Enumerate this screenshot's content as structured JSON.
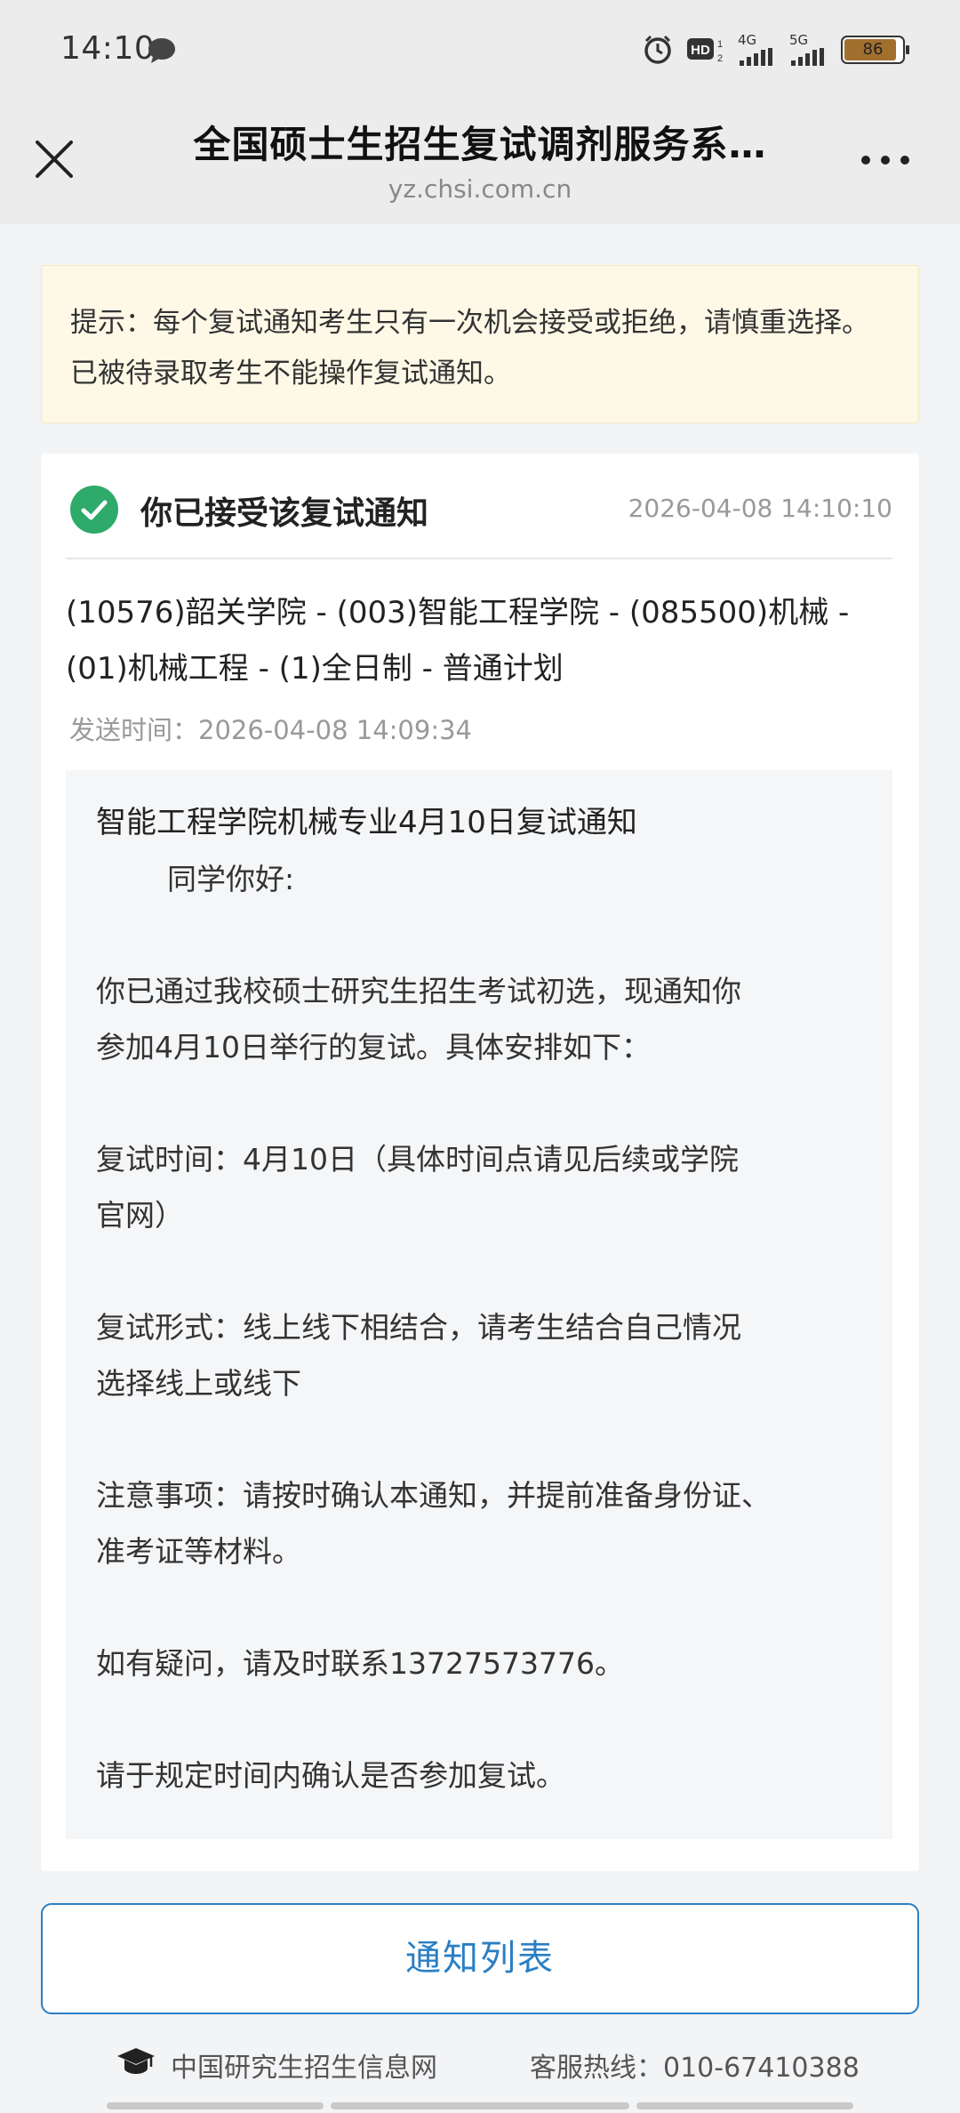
{
  "status_bar": {
    "time": "14:10",
    "network_1": "4G",
    "network_2": "5G",
    "hd_label": "HD",
    "battery": "86"
  },
  "header": {
    "title": "全国硕士生招生复试调剂服务系…",
    "url": "yz.chsi.com.cn"
  },
  "notice": {
    "text": "提示：每个复试通知考生只有一次机会接受或拒绝，请慎重选择。已被待录取考生不能操作复试通知。"
  },
  "card": {
    "status_text": "你已接受该复试通知",
    "status_time": "2026-04-08 14:10:10",
    "program_line1": "(10576)韶关学院 - (003)智能工程学院 - (085500)机械 -",
    "program_line2": "(01)机械工程 - (1)全日制 - 普通计划",
    "sent_time": "发送时间：2026-04-08 14:09:34",
    "message": {
      "title": "智能工程学院机械专业4月10日复试通知",
      "greeting": "同学你好:",
      "intro_1": "你已通过我校硕士研究生招生考试初选，现通知你",
      "intro_2": "参加4月10日举行的复试。具体安排如下：",
      "time_1": "复试时间：4月10日（具体时间点请见后续或学院",
      "time_2": "官网）",
      "form_1": "复试形式：线上线下相结合，请考生结合自己情况",
      "form_2": "选择线上或线下",
      "notes_1": "注意事项：请按时确认本通知，并提前准备身份证、",
      "notes_2": "准考证等材料。",
      "contact": "如有疑问，请及时联系13727573776。",
      "confirm": "请于规定时间内确认是否参加复试。"
    }
  },
  "button": {
    "label": "通知列表"
  },
  "footer": {
    "org": "中国研究生招生信息网",
    "hotline": "客服热线：010-67410388"
  },
  "colors": {
    "accent": "#2a7fc4",
    "success": "#2eaa6a",
    "notice_bg": "#fef9e7"
  }
}
